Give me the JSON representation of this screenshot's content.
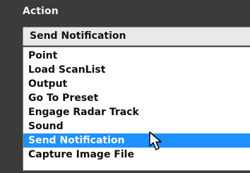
{
  "section": {
    "label": "Action"
  },
  "select": {
    "value": "Send Notification"
  },
  "listbox": {
    "options": [
      {
        "label": "Point"
      },
      {
        "label": "Load ScanList"
      },
      {
        "label": "Output"
      },
      {
        "label": "Go To Preset"
      },
      {
        "label": "Engage Radar Track"
      },
      {
        "label": "Sound"
      },
      {
        "label": "Send Notification"
      },
      {
        "label": "Capture Image File"
      }
    ],
    "selected_index": 6
  },
  "colors": {
    "background": "#3b3b3b",
    "highlight": "#1e90ff"
  },
  "icons": {
    "cursor": "pointer-arrow-icon"
  }
}
